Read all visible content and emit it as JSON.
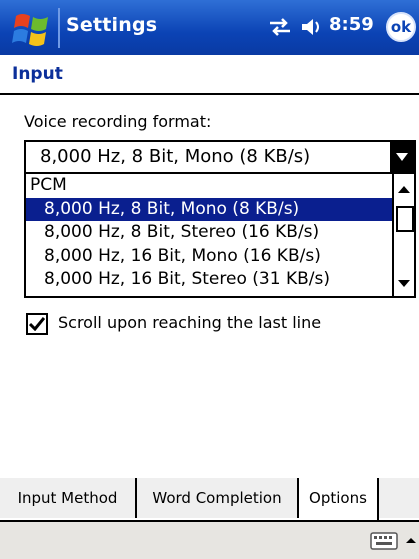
{
  "titlebar": {
    "title": "Settings",
    "time": "8:59",
    "ok_label": "ok",
    "icons": [
      "windows-flag-icon",
      "connectivity-icon",
      "volume-icon"
    ],
    "accent": "#0b43b5"
  },
  "page": {
    "title": "Input"
  },
  "voice_format": {
    "label": "Voice recording format:",
    "selected": "8,000 Hz, 8 Bit, Mono (8 KB/s)",
    "options": [
      "PCM",
      "8,000 Hz, 8 Bit, Mono (8 KB/s)",
      "8,000 Hz, 8 Bit, Stereo (16 KB/s)",
      "8,000 Hz, 16 Bit, Mono (16 KB/s)",
      "8,000 Hz, 16 Bit, Stereo (31 KB/s)"
    ],
    "highlight_color": "#0a1f8f"
  },
  "scroll_option": {
    "label": "Scroll upon reaching the last line",
    "checked": true
  },
  "tabs": [
    {
      "label": "Input Method"
    },
    {
      "label": "Word Completion"
    },
    {
      "label": "Options",
      "active": true
    }
  ],
  "menubar": {
    "icons": [
      "keyboard-icon",
      "sip-arrow-icon"
    ]
  }
}
